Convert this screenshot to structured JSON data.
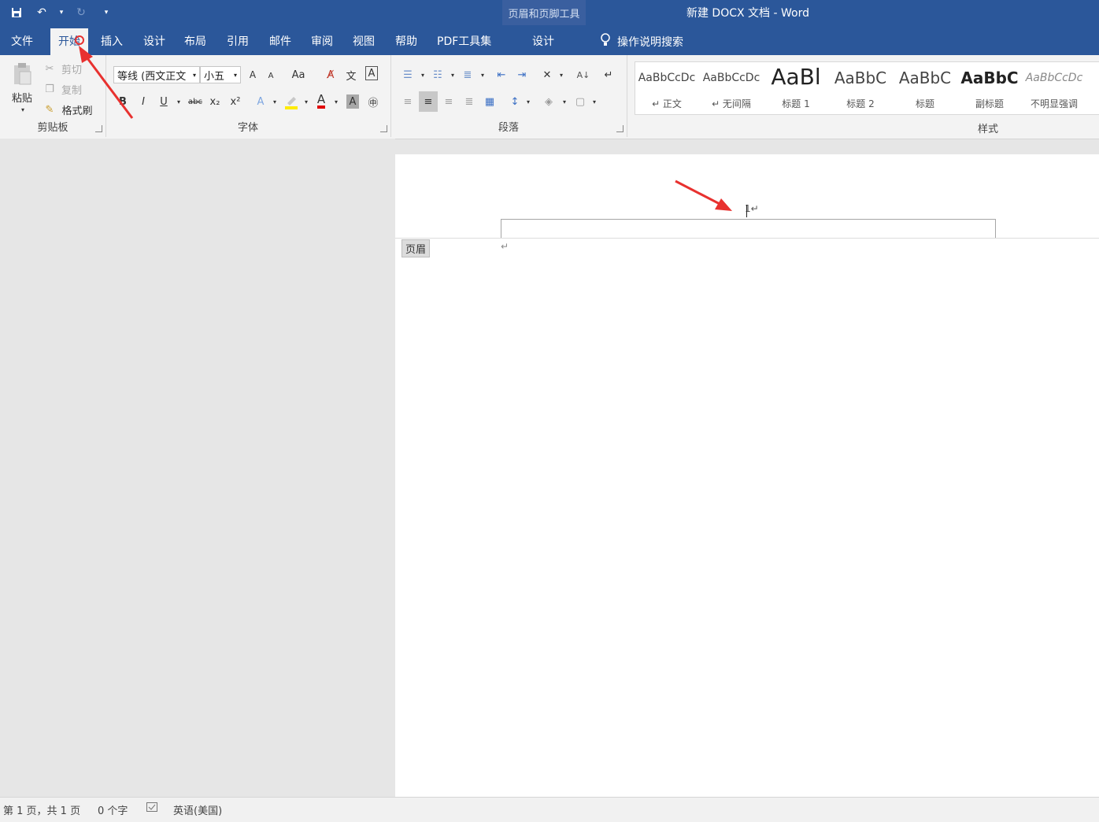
{
  "titlebar": {
    "contextual_title": "页眉和页脚工具",
    "doc_title": "新建 DOCX 文档  -  Word"
  },
  "tabs": {
    "file": "文件",
    "home": "开始",
    "insert": "插入",
    "design": "设计",
    "layout": "布局",
    "references": "引用",
    "mailings": "邮件",
    "review": "审阅",
    "view": "视图",
    "help": "帮助",
    "pdf": "PDF工具集",
    "hf_design": "设计",
    "tell_me": "操作说明搜索"
  },
  "clipboard": {
    "paste": "粘贴",
    "cut": "剪切",
    "copy": "复制",
    "format_painter": "格式刷",
    "label": "剪贴板"
  },
  "font": {
    "name": "等线 (西文正文",
    "size": "小五",
    "label": "字体",
    "bold": "B",
    "italic": "I",
    "underline": "U",
    "strike": "abc",
    "sub": "x₂",
    "sup": "x²",
    "grow": "A",
    "shrink": "A",
    "case": "Aa",
    "color_a": "A",
    "shade_a": "A"
  },
  "paragraph": {
    "label": "段落"
  },
  "styles": {
    "label": "样式",
    "items": [
      {
        "sample": "AaBbCcDc",
        "name": "↵ 正文"
      },
      {
        "sample": "AaBbCcDc",
        "name": "↵ 无间隔"
      },
      {
        "sample": "AaBl",
        "name": "标题 1"
      },
      {
        "sample": "AaBbC",
        "name": "标题 2"
      },
      {
        "sample": "AaBbC",
        "name": "标题"
      },
      {
        "sample": "AaBbC",
        "name": "副标题"
      },
      {
        "sample": "AaBbCcDc",
        "name": "不明显强调"
      }
    ]
  },
  "document": {
    "header_tag": "页眉",
    "page_number": "1↵",
    "paragraph_mark": "↵"
  },
  "status": {
    "page": "第 1 页，共 1 页",
    "words": "0 个字",
    "language": "英语(美国)"
  },
  "colors": {
    "brand": "#2b579a",
    "arrow": "#e8312f"
  }
}
